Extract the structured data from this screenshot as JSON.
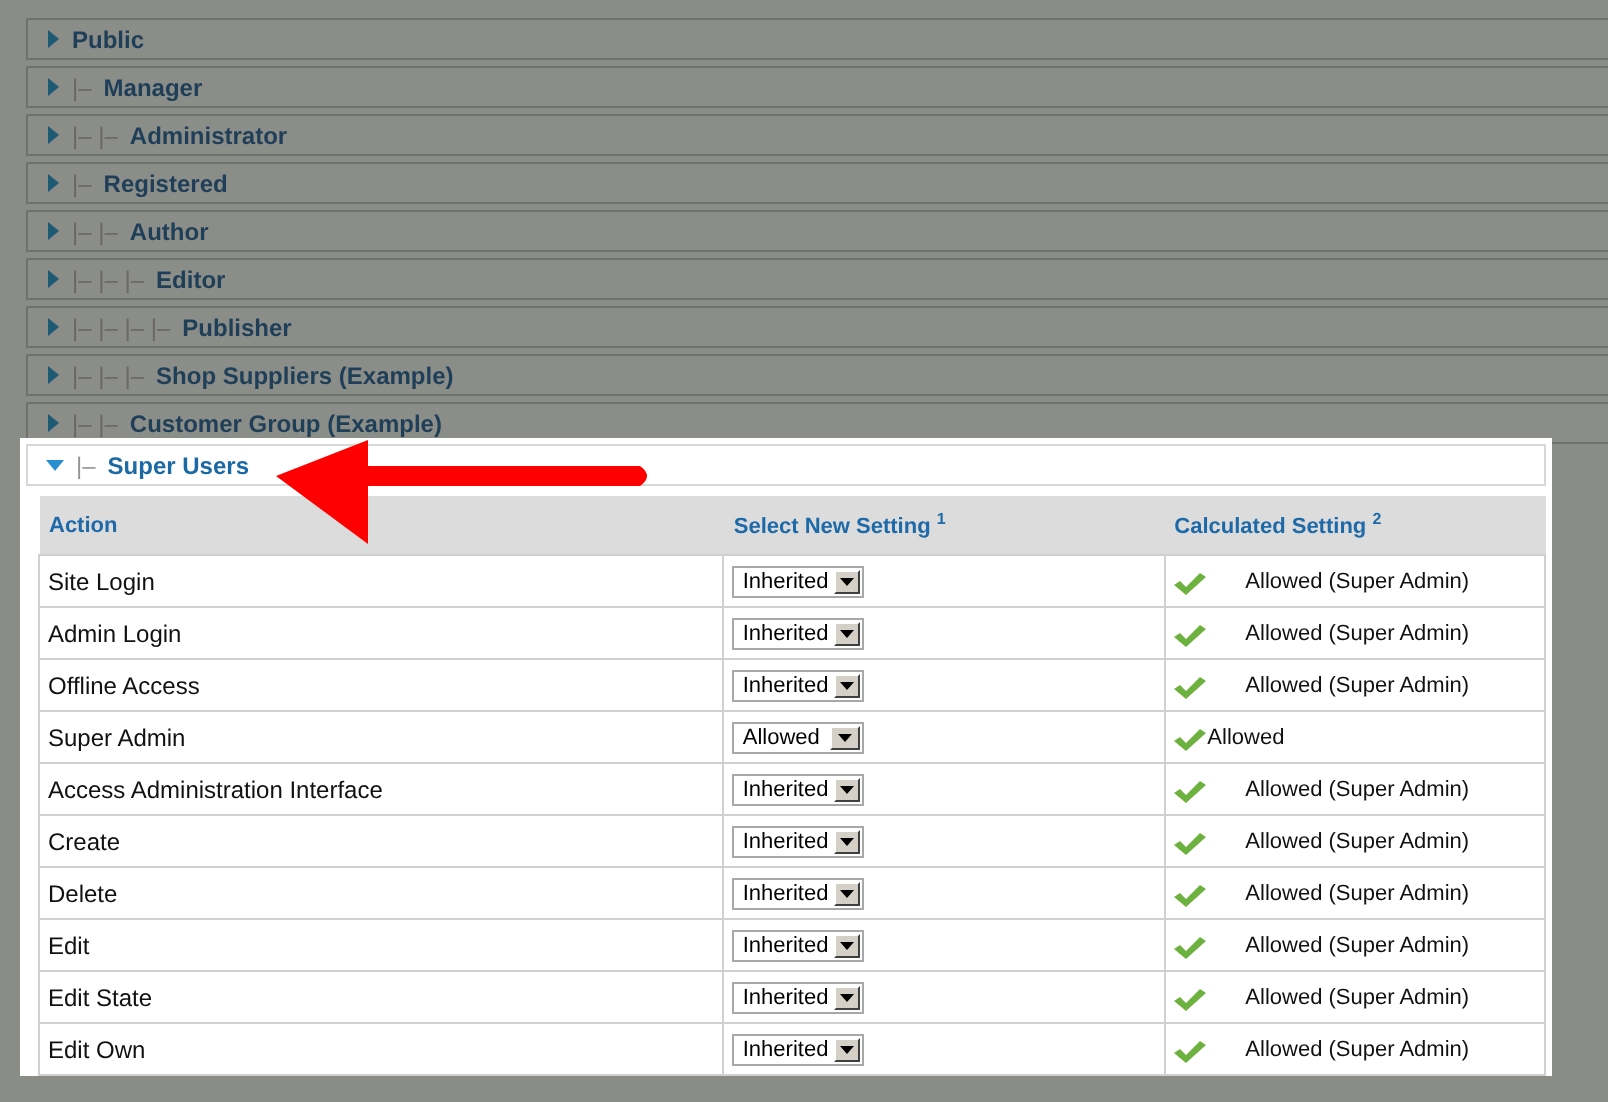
{
  "groups": [
    {
      "label": "Public",
      "expanded": false,
      "dimmed": true
    },
    {
      "prefix": "|–",
      "label": "Manager",
      "expanded": false,
      "dimmed": true
    },
    {
      "prefix": "|– |–",
      "label": "Administrator",
      "expanded": false,
      "dimmed": true
    },
    {
      "prefix": "|–",
      "label": "Registered",
      "expanded": false,
      "dimmed": true
    },
    {
      "prefix": "|– |–",
      "label": "Author",
      "expanded": false,
      "dimmed": true
    },
    {
      "prefix": "|– |– |–",
      "label": "Editor",
      "expanded": false,
      "dimmed": true
    },
    {
      "prefix": "|– |– |– |–",
      "label": "Publisher",
      "expanded": false,
      "dimmed": true
    },
    {
      "prefix": "|– |– |–",
      "label": "Shop Suppliers (Example)",
      "expanded": false,
      "dimmed": true
    },
    {
      "prefix": "|– |–",
      "label": "Customer Group (Example)",
      "expanded": false,
      "dimmed": true
    },
    {
      "prefix": "|–",
      "label": "Super Users",
      "expanded": true,
      "dimmed": false
    }
  ],
  "table": {
    "columns": [
      "Action",
      "Select New Setting $^{1}$",
      "Calculated Setting $^{2}$"
    ],
    "rows": [
      {
        "action": "Site Login",
        "setting": "Inherited",
        "calculated": "Allowed (Super Admin)",
        "kind": "super_admin"
      },
      {
        "action": "Admin Login",
        "setting": "Inherited",
        "calculated": "Allowed (Super Admin)",
        "kind": "super_admin"
      },
      {
        "action": "Offline Access",
        "setting": "Inherited",
        "calculated": "Allowed (Super Admin)",
        "kind": "super_admin"
      },
      {
        "action": "Super Admin",
        "setting": "Allowed",
        "calculated": "Allowed",
        "kind": "explicit"
      },
      {
        "action": "Access Administration Interface",
        "setting": "Inherited",
        "calculated": "Allowed (Super Admin)",
        "kind": "super_admin"
      },
      {
        "action": "Create",
        "setting": "Inherited",
        "calculated": "Allowed (Super Admin)",
        "kind": "super_admin"
      },
      {
        "action": "Delete",
        "setting": "Inherited",
        "calculated": "Allowed (Super Admin)",
        "kind": "super_admin"
      },
      {
        "action": "Edit",
        "setting": "Inherited",
        "calculated": "Allowed (Super Admin)",
        "kind": "super_admin"
      },
      {
        "action": "Edit State",
        "setting": "Inherited",
        "calculated": "Allowed (Super Admin)",
        "kind": "super_admin"
      },
      {
        "action": "Edit Own",
        "setting": "Inherited",
        "calculated": "Allowed (Super Admin)",
        "kind": "super_admin"
      }
    ]
  },
  "annotation": {
    "kind": "arrow"
  }
}
